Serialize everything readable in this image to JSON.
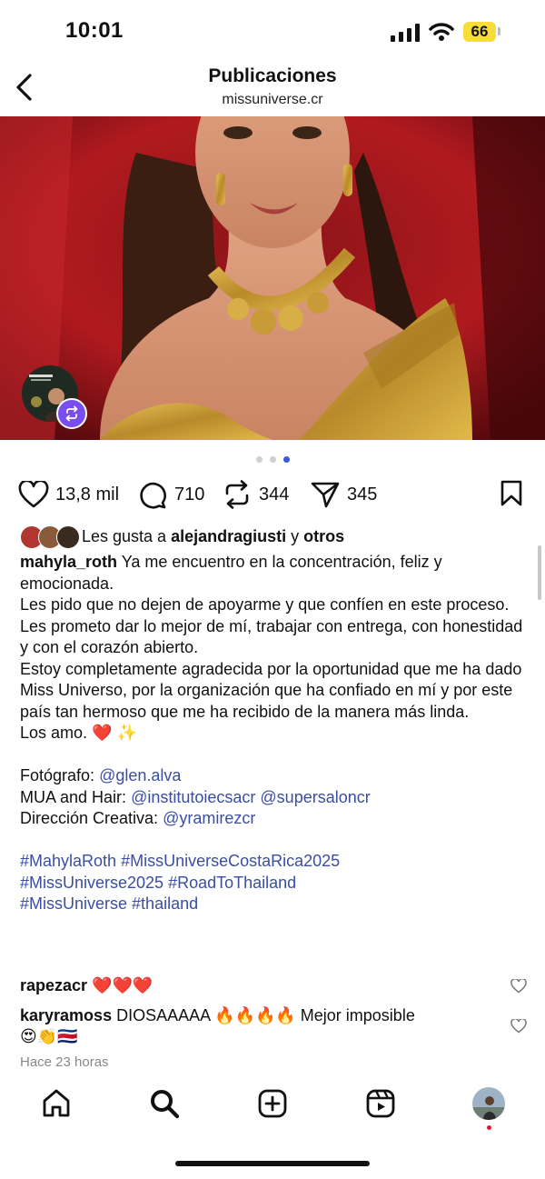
{
  "status_bar": {
    "time": "10:01",
    "battery": "66"
  },
  "header": {
    "title": "Publicaciones",
    "subtitle": "missuniverse.cr"
  },
  "carousel": {
    "count": 3,
    "active_index": 2
  },
  "actions": {
    "likes": "13,8 mil",
    "comments": "710",
    "reposts": "344",
    "shares": "345"
  },
  "liked_by": {
    "prefix": "Les gusta a",
    "user": "alejandragiusti",
    "connector": "y",
    "others": "otros"
  },
  "caption": {
    "username": "mahyla_roth",
    "first_line": "Ya me encuentro en la concentración, feliz y emocionada.",
    "paragraphs": [
      "Les pido que no dejen de apoyarme y que confíen en este proceso.",
      "Les prometo dar lo mejor de mí, trabajar con entrega, con honestidad y con el corazón abierto.",
      "Estoy completamente agradecida por la oportunidad que me ha dado Miss Universo, por la organización que ha confiado en mí y por este país tan hermoso que me ha recibido de la manera más linda."
    ],
    "closing": "Los amo.",
    "closing_emoji": "❤️ ✨",
    "credits": [
      {
        "label": "Fotógrafo:",
        "mentions": [
          "@glen.alva"
        ]
      },
      {
        "label": "MUA and Hair:",
        "mentions": [
          "@institutoiecsacr",
          "@supersaloncr"
        ]
      },
      {
        "label": "Dirección Creativa:",
        "mentions": [
          "@yramirezcr"
        ]
      }
    ],
    "hashtags": [
      [
        "#MahylaRoth",
        "#MissUniverseCostaRica2025"
      ],
      [
        "#MissUniverse2025",
        "#RoadToThailand"
      ],
      [
        "#MissUniverse",
        "#thailand"
      ]
    ]
  },
  "comments": [
    {
      "user": "rapezacr",
      "text": "❤️❤️❤️"
    },
    {
      "user": "karyramoss",
      "text": "DIOSAAAAA 🔥🔥🔥🔥 Mejor imposible",
      "text2": "😍👏🇨🇷"
    }
  ],
  "time_ago": "Hace 23 horas",
  "colors": {
    "link": "#3a4ea3",
    "active_dot": "#3a5bd9",
    "repost_badge": "#7a4df0",
    "battery": "#f7dd3b"
  },
  "tab_bar": [
    "home-icon",
    "search-icon",
    "create-icon",
    "reels-icon",
    "profile-avatar"
  ]
}
